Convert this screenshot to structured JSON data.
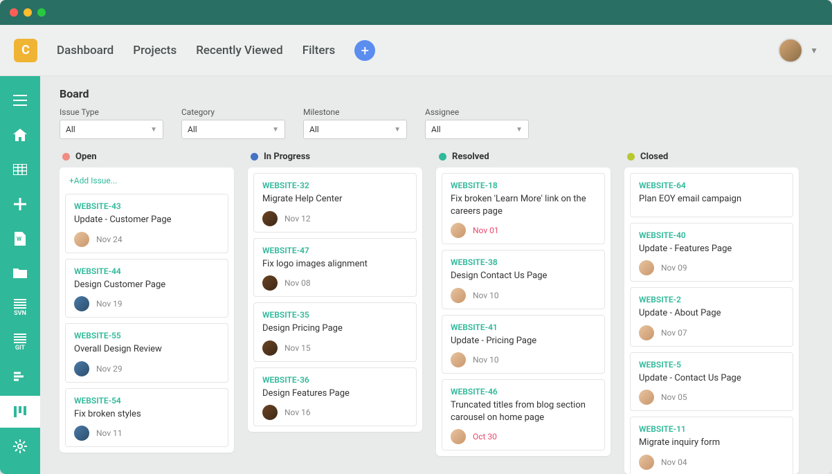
{
  "logo_letter": "C",
  "nav": {
    "dashboard": "Dashboard",
    "projects": "Projects",
    "recently_viewed": "Recently Viewed",
    "filters": "Filters"
  },
  "sidebar": {
    "svn": "SVN",
    "git": "GIT"
  },
  "page_title": "Board",
  "filters": {
    "issue_type": {
      "label": "Issue Type",
      "value": "All"
    },
    "category": {
      "label": "Category",
      "value": "All"
    },
    "milestone": {
      "label": "Milestone",
      "value": "All"
    },
    "assignee": {
      "label": "Assignee",
      "value": "All"
    }
  },
  "add_issue_label": "+Add Issue...",
  "columns": [
    {
      "title": "Open",
      "color": "#f28b82",
      "show_add": true,
      "cards": [
        {
          "id": "WEBSITE-43",
          "title": "Update - Customer Page",
          "date": "Nov 24",
          "avatar": "a3"
        },
        {
          "id": "WEBSITE-44",
          "title": "Design Customer Page",
          "date": "Nov 19",
          "avatar": "a4"
        },
        {
          "id": "WEBSITE-55",
          "title": "Overall Design Review",
          "date": "Nov 29",
          "avatar": "a4"
        },
        {
          "id": "WEBSITE-54",
          "title": "Fix broken styles",
          "date": "Nov 11",
          "avatar": "a4"
        }
      ]
    },
    {
      "title": "In Progress",
      "color": "#4472c4",
      "show_add": false,
      "cards": [
        {
          "id": "WEBSITE-32",
          "title": "Migrate Help Center",
          "date": "Nov 12",
          "avatar": "a2"
        },
        {
          "id": "WEBSITE-47",
          "title": "Fix logo images alignment",
          "date": "Nov 08",
          "avatar": "a2"
        },
        {
          "id": "WEBSITE-35",
          "title": "Design Pricing Page",
          "date": "Nov 15",
          "avatar": "a2"
        },
        {
          "id": "WEBSITE-36",
          "title": "Design Features Page",
          "date": "Nov 16",
          "avatar": "a2"
        }
      ]
    },
    {
      "title": "Resolved",
      "color": "#2fb89a",
      "show_add": false,
      "cards": [
        {
          "id": "WEBSITE-18",
          "title": "Fix broken 'Learn More' link on the careers page",
          "date": "Nov 01",
          "avatar": "a3",
          "overdue": true
        },
        {
          "id": "WEBSITE-38",
          "title": "Design Contact Us Page",
          "date": "Nov 10",
          "avatar": "a3"
        },
        {
          "id": "WEBSITE-41",
          "title": "Update - Pricing Page",
          "date": "Nov 10",
          "avatar": "a3"
        },
        {
          "id": "WEBSITE-46",
          "title": "Truncated titles from blog section carousel on home page",
          "date": "Oct 30",
          "avatar": "a3",
          "overdue": true
        }
      ]
    },
    {
      "title": "Closed",
      "color": "#b8c92f",
      "show_add": false,
      "cards": [
        {
          "id": "WEBSITE-64",
          "title": "Plan EOY email campaign",
          "date": "",
          "avatar": ""
        },
        {
          "id": "WEBSITE-40",
          "title": "Update - Features Page",
          "date": "Nov 09",
          "avatar": "a3"
        },
        {
          "id": "WEBSITE-2",
          "title": "Update - About Page",
          "date": "Nov 07",
          "avatar": "a3"
        },
        {
          "id": "WEBSITE-5",
          "title": "Update - Contact Us Page",
          "date": "Nov 05",
          "avatar": "a3"
        },
        {
          "id": "WEBSITE-11",
          "title": "Migrate inquiry form",
          "date": "Nov 04",
          "avatar": "a3"
        }
      ]
    }
  ]
}
